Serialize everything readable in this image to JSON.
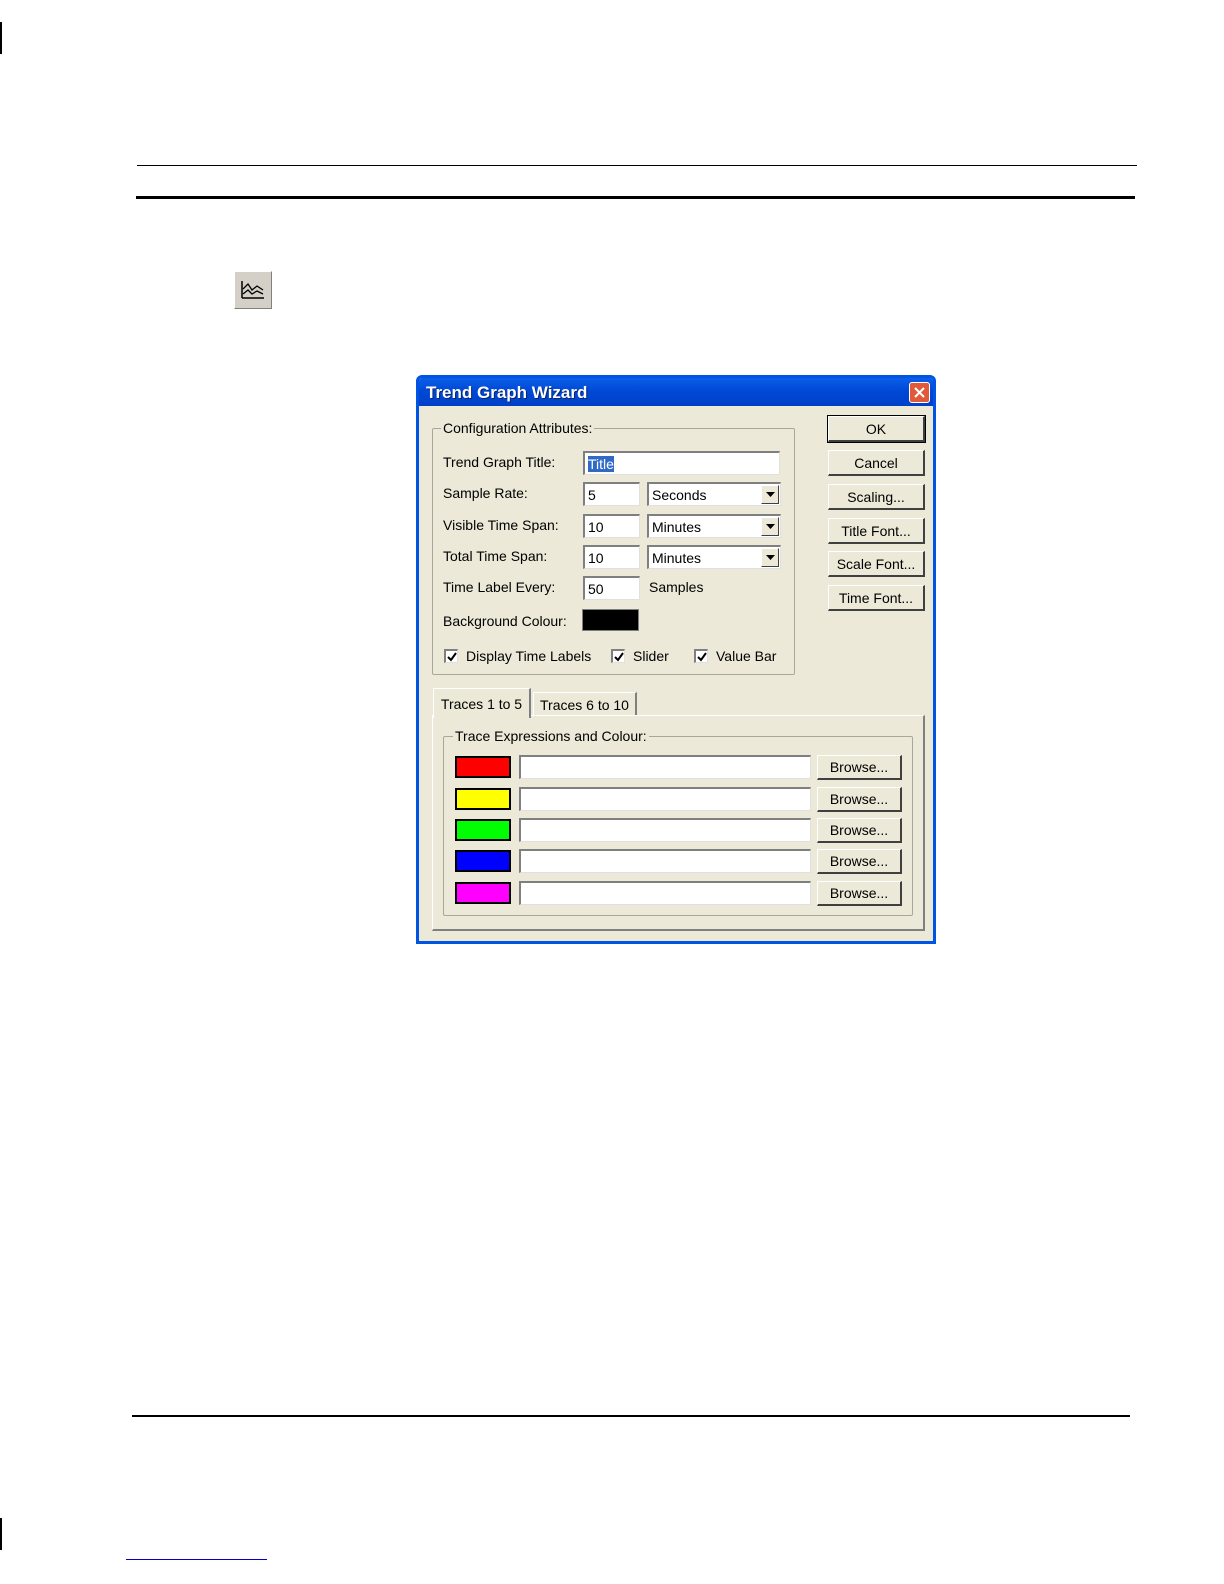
{
  "dialog": {
    "title": "Trend Graph Wizard",
    "config_group_label": "Configuration Attributes:",
    "fields": {
      "title_label": "Trend Graph Title:",
      "title_value": "Title",
      "sample_rate_label": "Sample Rate:",
      "sample_rate_value": "5",
      "sample_rate_unit": "Seconds",
      "visible_span_label": "Visible Time Span:",
      "visible_span_value": "10",
      "visible_span_unit": "Minutes",
      "total_span_label": "Total Time Span:",
      "total_span_value": "10",
      "total_span_unit": "Minutes",
      "time_label_every_label": "Time Label Every:",
      "time_label_every_value": "50",
      "time_label_every_unit": "Samples",
      "background_colour_label": "Background Colour:",
      "background_colour": "#000000"
    },
    "checkboxes": {
      "display_time_labels": "Display Time Labels",
      "slider": "Slider",
      "value_bar": "Value Bar"
    },
    "buttons": {
      "ok": "OK",
      "cancel": "Cancel",
      "scaling": "Scaling...",
      "title_font": "Title Font...",
      "scale_font": "Scale Font...",
      "time_font": "Time Font..."
    },
    "tabs": [
      "Traces 1 to 5",
      "Traces 6 to 10"
    ],
    "trace_group_label": "Trace Expressions and Colour:",
    "traces": [
      {
        "color": "#ff0000",
        "browse": "Browse..."
      },
      {
        "color": "#ffff00",
        "browse": "Browse..."
      },
      {
        "color": "#00ff00",
        "browse": "Browse..."
      },
      {
        "color": "#0000ff",
        "browse": "Browse..."
      },
      {
        "color": "#ff00ff",
        "browse": "Browse..."
      }
    ]
  },
  "icons": {
    "toolbar_icon": "trend-graph-icon",
    "close": "close-icon",
    "dropdown": "chevron-down-icon",
    "check": "check-icon"
  }
}
